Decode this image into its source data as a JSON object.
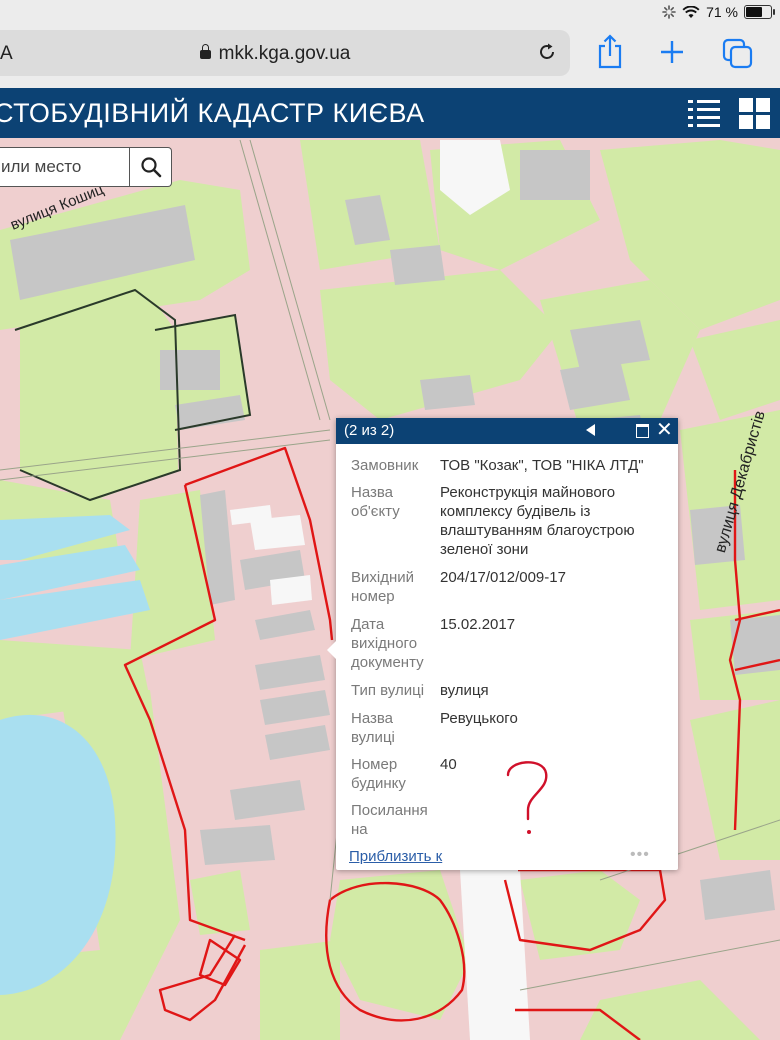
{
  "status_bar": {
    "battery": "71 %",
    "battery_level": 0.71
  },
  "browser": {
    "left_char": "A",
    "url": "mkk.kga.gov.ua",
    "icons": [
      "lock-icon",
      "reload-icon",
      "share-icon",
      "new-tab-icon",
      "tabs-icon"
    ]
  },
  "app": {
    "title": "СТОБУДІВНИЙ КАДАСТР КИЄВА",
    "header_icons": [
      "list-icon",
      "grid-icon"
    ]
  },
  "search": {
    "placeholder": "или место"
  },
  "map": {
    "labels": {
      "street_top": "вулиця Кошиц",
      "street_right": "вулиця Декабристів"
    },
    "colors": {
      "road": "#efcfcf",
      "green": "#d2eaa6",
      "water": "#a9dff0",
      "building": "#c6c6c6",
      "boundary": "#e01616"
    }
  },
  "popup": {
    "counter": "(2 из 2)",
    "rows": [
      {
        "label": "Замовник",
        "value": "ТОВ \"Козак\", ТОВ \"НІКА ЛТД\""
      },
      {
        "label": "Назва об'єкту",
        "value": "Реконструкція майнового комплексу будівель із влаштуванням благоустрою зеленої зони"
      },
      {
        "label": "Вихідний номер",
        "value": "204/17/012/009-17"
      },
      {
        "label": "Дата вихідного документу",
        "value": "15.02.2017"
      },
      {
        "label": "Тип вулиці",
        "value": "вулиця"
      },
      {
        "label": "Назва вулиці",
        "value": "Ревуцького"
      },
      {
        "label": "Номер будинку",
        "value": "40"
      },
      {
        "label": "Посилання на",
        "value": ""
      }
    ],
    "zoom_link": "Приблизить к",
    "more": "•••"
  }
}
